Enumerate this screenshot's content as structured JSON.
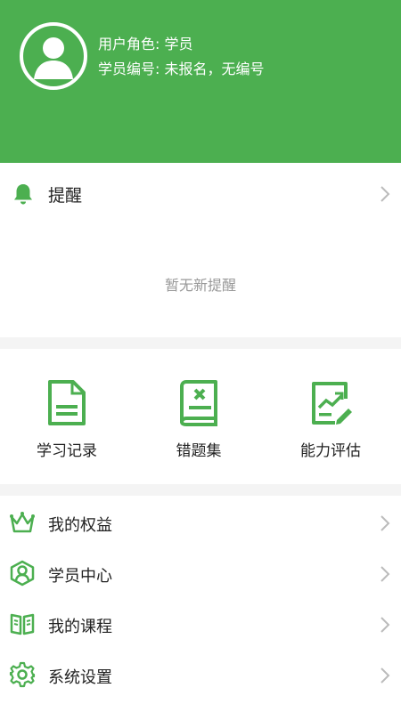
{
  "header": {
    "role_label": "用户角色: 学员",
    "student_id_label": "学员编号: 未报名，无编号"
  },
  "reminders": {
    "title": "提醒",
    "empty_text": "暂无新提醒",
    "icon": "bell-icon"
  },
  "features": [
    {
      "label": "学习记录",
      "icon": "document-icon"
    },
    {
      "label": "错题集",
      "icon": "book-icon"
    },
    {
      "label": "能力评估",
      "icon": "chart-edit-icon"
    }
  ],
  "menu": [
    {
      "label": "我的权益",
      "icon": "crown-icon"
    },
    {
      "label": "学员中心",
      "icon": "user-hexagon-icon"
    },
    {
      "label": "我的课程",
      "icon": "open-book-icon"
    },
    {
      "label": "系统设置",
      "icon": "gear-icon"
    }
  ],
  "colors": {
    "brand_green": "#4caf50",
    "chevron_gray": "#bbbbbb",
    "muted_text": "#999999"
  }
}
